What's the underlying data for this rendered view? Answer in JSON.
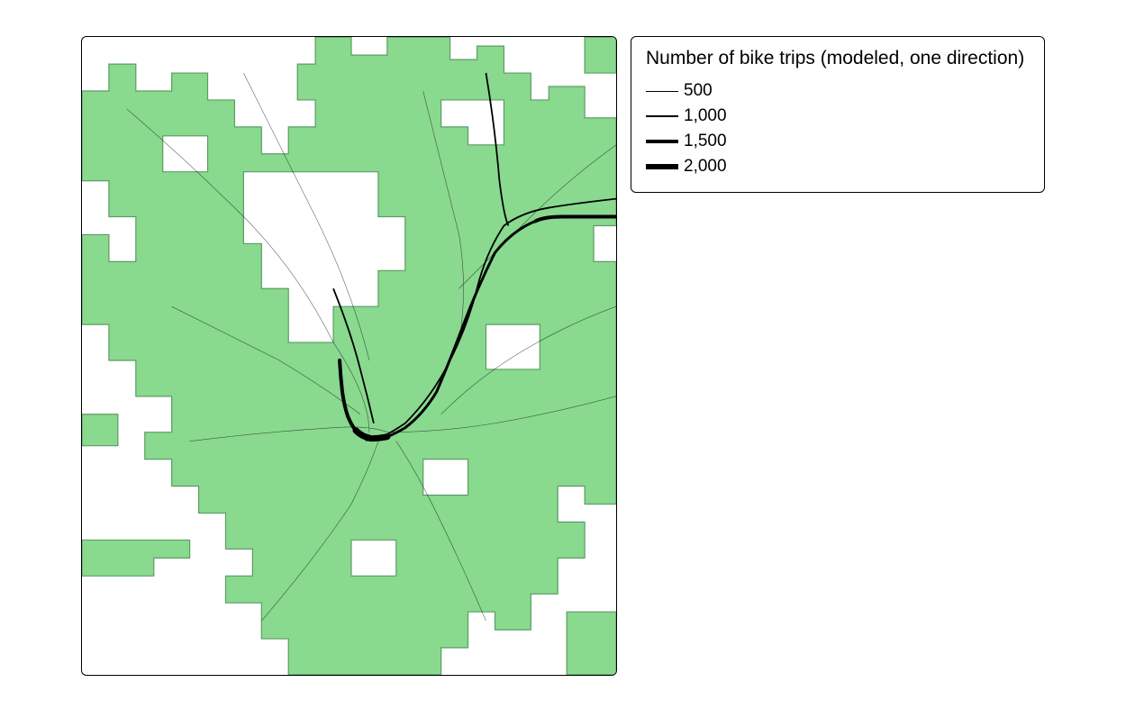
{
  "legend": {
    "title": "Number of bike trips (modeled, one direction)",
    "items": [
      {
        "label": "500",
        "stroke_px": 1
      },
      {
        "label": "1,000",
        "stroke_px": 2
      },
      {
        "label": "1,500",
        "stroke_px": 4
      },
      {
        "label": "2,000",
        "stroke_px": 6
      }
    ]
  },
  "map": {
    "region_fill": "#89d98f",
    "region_stroke": "#5c9c63",
    "route_color": "#000000",
    "background": "#ffffff"
  }
}
